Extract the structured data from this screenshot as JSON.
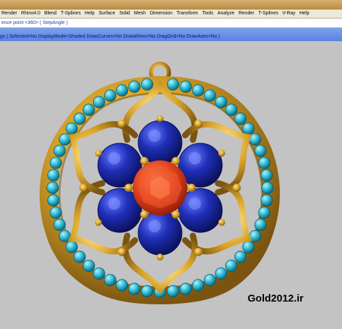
{
  "menu": {
    "items": [
      "Render",
      "Rhino4.0",
      "Blend",
      "T-Splines",
      "Help",
      "Surface",
      "Solid",
      "Mesh",
      "Dimension",
      "Transform",
      "Tools",
      "Analyze",
      "Render",
      "T-Splines",
      "V-Ray",
      "Help"
    ]
  },
  "command": {
    "prompt": "ence point <360> ( StepAngle )"
  },
  "options": {
    "text": "gs ( Selected=No  DisplayMode=Shaded  DrawCurves=No  DrawWires=No  DragGrid=No  DrawAxes=No )"
  },
  "watermark": {
    "text": "Gold2012.ir"
  },
  "colors": {
    "gold": "#d9a42a",
    "sapphire": "#1f2fb8",
    "ruby": "#e0401c",
    "turquoise": "#2fb8d0"
  }
}
